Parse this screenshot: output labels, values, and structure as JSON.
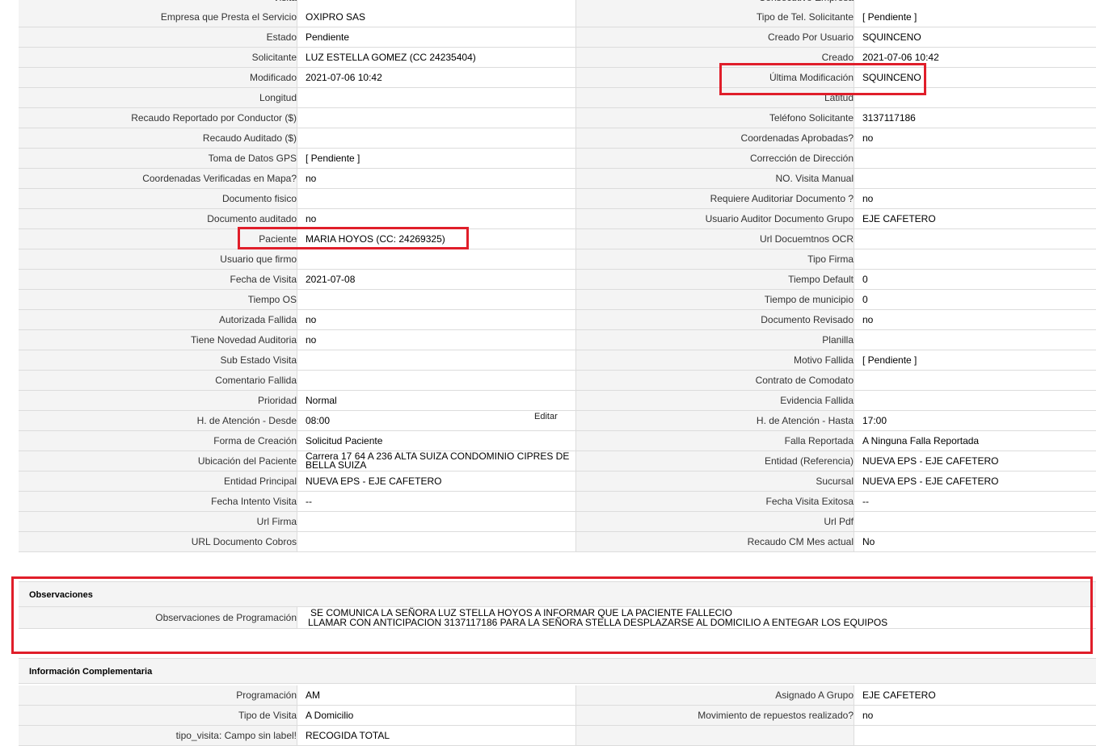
{
  "top_partial": {
    "left_label": "Visita",
    "right_label": "Consecutivo Empresa"
  },
  "rows": [
    {
      "l1": "Empresa que Presta el Servicio",
      "v1": "OXIPRO SAS",
      "l2": "Tipo de Tel. Solicitante",
      "v2": "[ Pendiente ]"
    },
    {
      "l1": "Estado",
      "v1": "Pendiente",
      "l2": "Creado Por Usuario",
      "v2": "SQUINCENO"
    },
    {
      "l1": "Solicitante",
      "v1": "LUZ ESTELLA GOMEZ (CC 24235404)",
      "l2": "Creado",
      "v2": "2021-07-06 10:42"
    },
    {
      "l1": "Modificado",
      "v1": "2021-07-06 10:42",
      "l2": "Última Modificación",
      "v2": " SQUINCENO"
    },
    {
      "l1": "Longitud",
      "v1": "",
      "l2": "Latitud",
      "v2": ""
    },
    {
      "l1": "Recaudo Reportado por Conductor ($)",
      "v1": "",
      "l2": "Teléfono Solicitante",
      "v2": "3137117186"
    },
    {
      "l1": "Recaudo Auditado ($)",
      "v1": "",
      "l2": "Coordenadas Aprobadas?",
      "v2": " no"
    },
    {
      "l1": "Toma de Datos GPS",
      "v1": "[ Pendiente ]",
      "l2": "Corrección de Dirección",
      "v2": ""
    },
    {
      "l1": "Coordenadas Verificadas en Mapa?",
      "v1": " no",
      "l2": "NO. Visita Manual",
      "v2": ""
    },
    {
      "l1": "Documento fisico",
      "v1": "",
      "l2": "Requiere Auditoriar Documento ?",
      "v2": " no"
    },
    {
      "l1": "Documento auditado",
      "v1": " no",
      "l2": "Usuario Auditor Documento Grupo",
      "v2": "EJE CAFETERO"
    },
    {
      "l1": "Paciente",
      "v1": "MARIA HOYOS (CC: 24269325)",
      "l2": "Url Docuemtnos OCR",
      "v2": ""
    },
    {
      "l1": "Usuario que firmo",
      "v1": "",
      "l2": "Tipo Firma",
      "v2": ""
    },
    {
      "l1": "Fecha de Visita",
      "v1": " 2021-07-08",
      "l2": "Tiempo Default",
      "v2": "0"
    },
    {
      "l1": "Tiempo OS",
      "v1": "",
      "l2": "Tiempo de municipio",
      "v2": "0"
    },
    {
      "l1": "Autorizada Fallida",
      "v1": " no",
      "l2": "Documento Revisado",
      "v2": " no"
    },
    {
      "l1": "Tiene Novedad Auditoria",
      "v1": " no",
      "l2": "Planilla",
      "v2": ""
    },
    {
      "l1": "Sub Estado Visita",
      "v1": "",
      "l2": "Motivo Fallida",
      "v2": "[ Pendiente ]"
    },
    {
      "l1": "Comentario Fallida",
      "v1": "",
      "l2": "Contrato de Comodato",
      "v2": ""
    },
    {
      "l1": "Prioridad",
      "v1": "Normal",
      "l2": "Evidencia Fallida",
      "v2": ""
    },
    {
      "l1": "H. de Atención - Desde",
      "v1": "08:00",
      "l2": "H. de Atención - Hasta",
      "v2": "17:00"
    },
    {
      "l1": "Forma de Creación",
      "v1": "Solicitud Paciente",
      "l2": "Falla Reportada",
      "v2": "A Ninguna Falla Reportada"
    },
    {
      "l1": "Ubicación del Paciente",
      "v1": "Carrera 17 64 A 236 ALTA SUIZA CONDOMINIO CIPRES DE BELLA SUIZA",
      "l2": "Entidad (Referencia)",
      "v2": "NUEVA EPS - EJE CAFETERO"
    },
    {
      "l1": "Entidad Principal",
      "v1": "NUEVA EPS - EJE CAFETERO",
      "l2": "Sucursal",
      "v2": "NUEVA EPS - EJE CAFETERO"
    },
    {
      "l1": "Fecha Intento Visita",
      "v1": "--",
      "l2": "Fecha Visita Exitosa",
      "v2": "--"
    },
    {
      "l1": "Url Firma",
      "v1": "",
      "l2": "Url Pdf",
      "v2": ""
    },
    {
      "l1": "URL Documento Cobros",
      "v1": "",
      "l2": "Recaudo CM Mes actual",
      "v2": "No"
    }
  ],
  "edit_link": "Editar",
  "observaciones": {
    "title": "Observaciones",
    "label": "Observaciones de Programación",
    "line1": "SE COMUNICA LA SEÑORA LUZ STELLA HOYOS A INFORMAR QUE LA PACIENTE FALLECIO",
    "line2": "LLAMAR CON ANTICIPACION 3137117186 PARA LA SEÑORA STELLA DESPLAZARSE AL DOMICILIO A ENTEGAR LOS EQUIPOS"
  },
  "info": {
    "title": "Información Complementaria",
    "rows": [
      {
        "l1": "Programación",
        "v1": "AM",
        "l2": "Asignado A Grupo",
        "v2": "EJE CAFETERO"
      },
      {
        "l1": "Tipo de Visita",
        "v1": "A Domicilio",
        "l2": "Movimiento de repuestos realizado?",
        "v2": " no"
      },
      {
        "l1": "tipo_visita: Campo sin label!",
        "v1": "RECOGIDA TOTAL",
        "l2": "",
        "v2": ""
      }
    ]
  },
  "colors": {
    "highlight": "#e01e2a",
    "label_bg": "#f4f4f4",
    "border": "#dcdcdc"
  }
}
